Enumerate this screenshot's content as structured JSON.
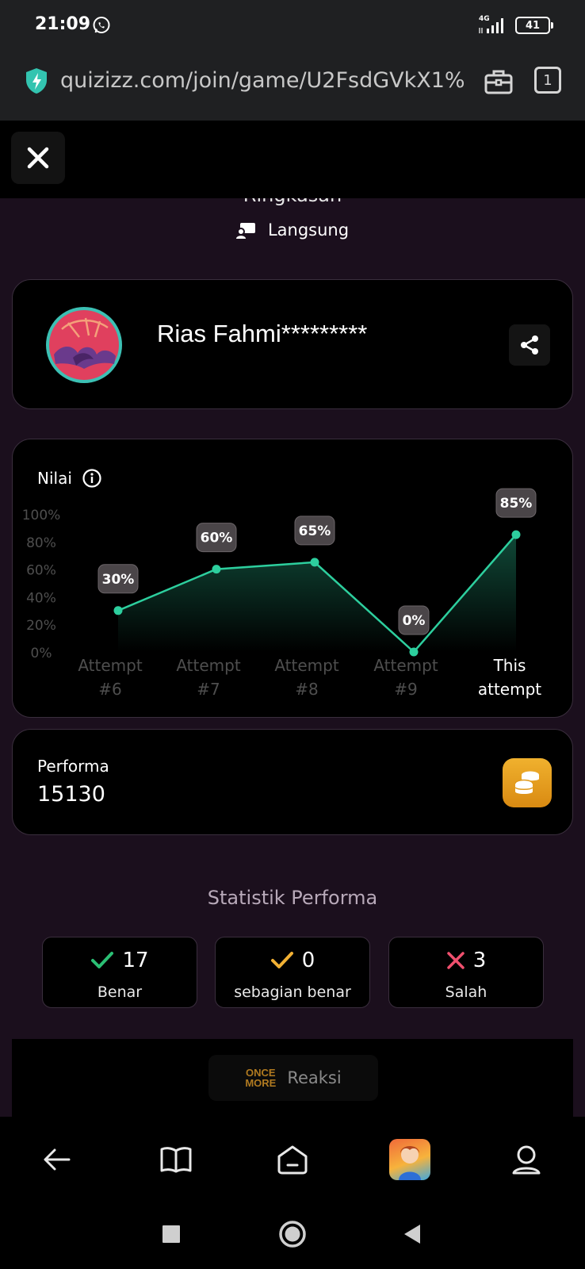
{
  "status_bar": {
    "time": "21:09",
    "network": "4G",
    "battery": "41"
  },
  "browser": {
    "url": "quizizz.com/join/game/U2FsdGVkX1%252E",
    "tabs_count": "1"
  },
  "header": {
    "cut_title": "Ringkasan",
    "mode_label": "Langsung"
  },
  "profile": {
    "name": "Rias Fahmi*********"
  },
  "chart_card": {
    "title": "Nilai"
  },
  "chart_data": {
    "type": "area",
    "categories": [
      "Attempt #6",
      "Attempt #7",
      "Attempt #8",
      "Attempt #9",
      "This attempt"
    ],
    "category_lines": [
      [
        "Attempt",
        "#6"
      ],
      [
        "Attempt",
        "#7"
      ],
      [
        "Attempt",
        "#8"
      ],
      [
        "Attempt",
        "#9"
      ],
      [
        "This",
        "attempt"
      ]
    ],
    "values": [
      30,
      60,
      65,
      0,
      85
    ],
    "labels": [
      "30%",
      "60%",
      "65%",
      "0%",
      "85%"
    ],
    "ylim": [
      0,
      100
    ],
    "yticks": [
      "0%",
      "20%",
      "40%",
      "60%",
      "80%",
      "100%"
    ],
    "line_color": "#2dcf9e",
    "grid": false,
    "highlight_last": true
  },
  "performance": {
    "label": "Performa",
    "value": "15130"
  },
  "stats": {
    "title": "Statistik Performa",
    "items": [
      {
        "value": "17",
        "label": "Benar",
        "color": "#2bbf74"
      },
      {
        "value": "0",
        "label": "sebagian benar",
        "color": "#f2b134"
      },
      {
        "value": "3",
        "label": "Salah",
        "color": "#f0506e"
      }
    ]
  },
  "reaction": {
    "icon_line1": "ONCE",
    "icon_line2": "MORE",
    "label": "Reaksi"
  },
  "colors": {
    "background": "#1b0f1d",
    "card": "#000000",
    "accent": "#2dcf9e",
    "coins": "#e9a224"
  }
}
